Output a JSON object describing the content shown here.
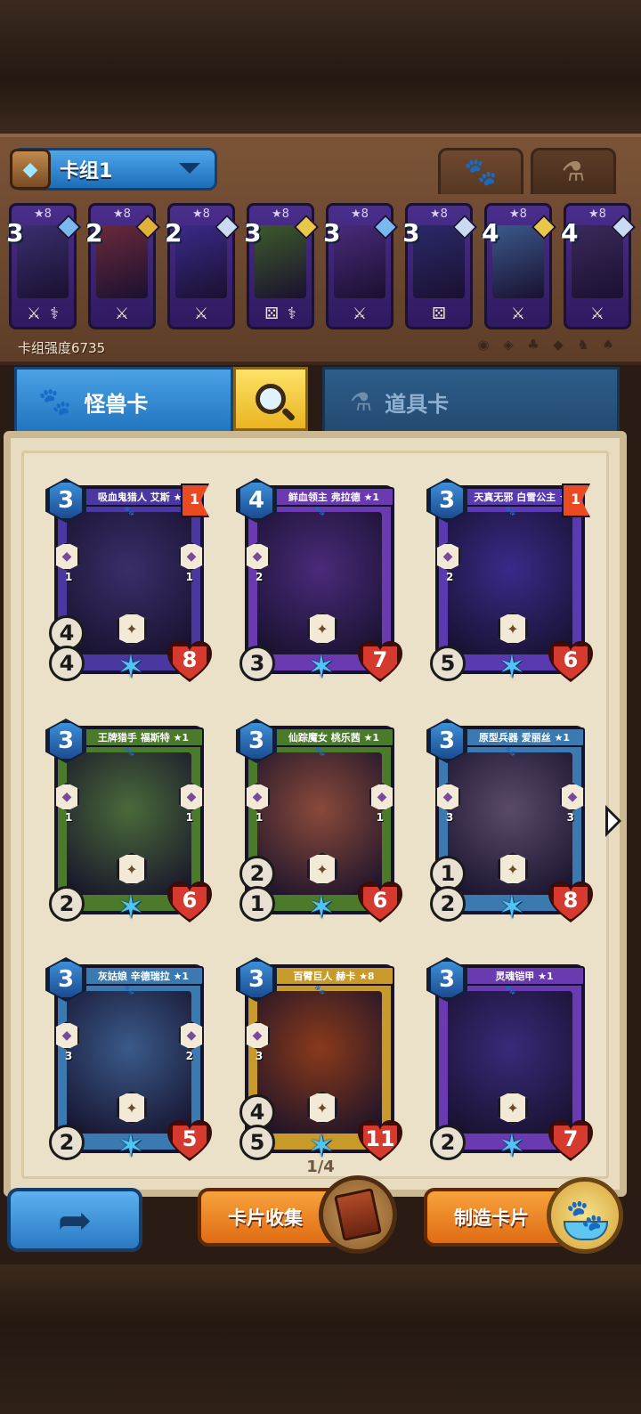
{
  "deck": {
    "name": "卡组1",
    "strength_label": "卡组强度6735",
    "filters": [
      "◉",
      "◈",
      "♣",
      "◆",
      "♞",
      "♠"
    ],
    "cards": [
      {
        "cost": "3",
        "stars": "★8",
        "gem_color": "#7ab8f0",
        "art": "#3b2f6e",
        "icons": [
          "⚔",
          "⚕"
        ]
      },
      {
        "cost": "2",
        "stars": "★8",
        "gem_color": "#e0b23a",
        "art": "#6a2a3a",
        "icons": [
          "⚔"
        ]
      },
      {
        "cost": "2",
        "stars": "★8",
        "gem_color": "#c9dbf0",
        "art": "#3a2a8a",
        "icons": [
          "⚔"
        ]
      },
      {
        "cost": "3",
        "stars": "★8",
        "gem_color": "#e7c84a",
        "art": "#3d5a2a",
        "icons": [
          "⚄",
          "⚕"
        ]
      },
      {
        "cost": "3",
        "stars": "★8",
        "gem_color": "#7ab8f0",
        "art": "#4a2a7a",
        "icons": [
          "⚔"
        ]
      },
      {
        "cost": "3",
        "stars": "★8",
        "gem_color": "#c9dbf0",
        "art": "#2a2a6a",
        "icons": [
          "⚄"
        ]
      },
      {
        "cost": "4",
        "stars": "★8",
        "gem_color": "#e7c84a",
        "art": "#3a5a8a",
        "icons": [
          "⚔"
        ]
      },
      {
        "cost": "4",
        "stars": "★8",
        "gem_color": "#c9dbf0",
        "art": "#3a2a5a",
        "icons": [
          "⚔"
        ]
      }
    ]
  },
  "tabs": {
    "monster": "怪兽卡",
    "item": "道具卡",
    "paw_icon": "paw-icon",
    "potion_icon": "potion-icon"
  },
  "cards": [
    {
      "title": "吸血鬼猎人 艾斯 ★8",
      "cost": "3",
      "flag": "1",
      "atk": "4",
      "atk2": "4",
      "hp": "8",
      "frame": "#4a38a0",
      "art": "#3a2e6a",
      "skill_l": "1",
      "skill_r": "1"
    },
    {
      "title": "鲜血领主 弗拉德 ★1",
      "cost": "4",
      "flag": "",
      "atk": "3",
      "atk2": "",
      "hp": "7",
      "frame": "#6a3ab0",
      "art": "#4a2a7a",
      "skill_l": "2",
      "skill_r": ""
    },
    {
      "title": "天真无邪 白雪公主 ★8",
      "cost": "3",
      "flag": "1",
      "atk": "5",
      "atk2": "",
      "hp": "6",
      "frame": "#5a3ab0",
      "art": "#3a2a8a",
      "skill_l": "2",
      "skill_r": ""
    },
    {
      "title": "王牌猎手 福斯特 ★1",
      "cost": "3",
      "flag": "",
      "atk": "2",
      "atk2": "",
      "hp": "6",
      "frame": "#4a7a2a",
      "art": "#4a6a3a",
      "skill_l": "1",
      "skill_r": "1"
    },
    {
      "title": "仙踪魔女 桃乐茜 ★1",
      "cost": "3",
      "flag": "",
      "atk": "1",
      "atk2": "2",
      "hp": "6",
      "frame": "#4a7a2a",
      "art": "#8a4a3a",
      "skill_l": "1",
      "skill_r": "1"
    },
    {
      "title": "原型兵器 爱丽丝 ★1",
      "cost": "3",
      "flag": "",
      "atk": "2",
      "atk2": "1",
      "hp": "8",
      "frame": "#3a7ab0",
      "art": "#5a4a6a",
      "skill_l": "3",
      "skill_r": "3"
    },
    {
      "title": "灰姑娘 辛德瑞拉 ★1",
      "cost": "3",
      "flag": "",
      "atk": "2",
      "atk2": "",
      "hp": "5",
      "frame": "#3a7ab0",
      "art": "#3a5a8a",
      "skill_l": "3",
      "skill_r": "2"
    },
    {
      "title": "百臂巨人 赫卡 ★8",
      "cost": "3",
      "flag": "",
      "atk": "5",
      "atk2": "4",
      "hp": "11",
      "frame": "#c89a2a",
      "art": "#8a3a1a",
      "skill_l": "3",
      "skill_r": ""
    },
    {
      "title": "灵魂铠甲 ★1",
      "cost": "3",
      "flag": "",
      "atk": "2",
      "atk2": "",
      "hp": "7",
      "frame": "#6a3ab0",
      "art": "#3a2a7a",
      "skill_l": "",
      "skill_r": ""
    }
  ],
  "pagination": "1/4",
  "buttons": {
    "back": "back",
    "collect": "卡片收集",
    "craft": "制造卡片"
  }
}
